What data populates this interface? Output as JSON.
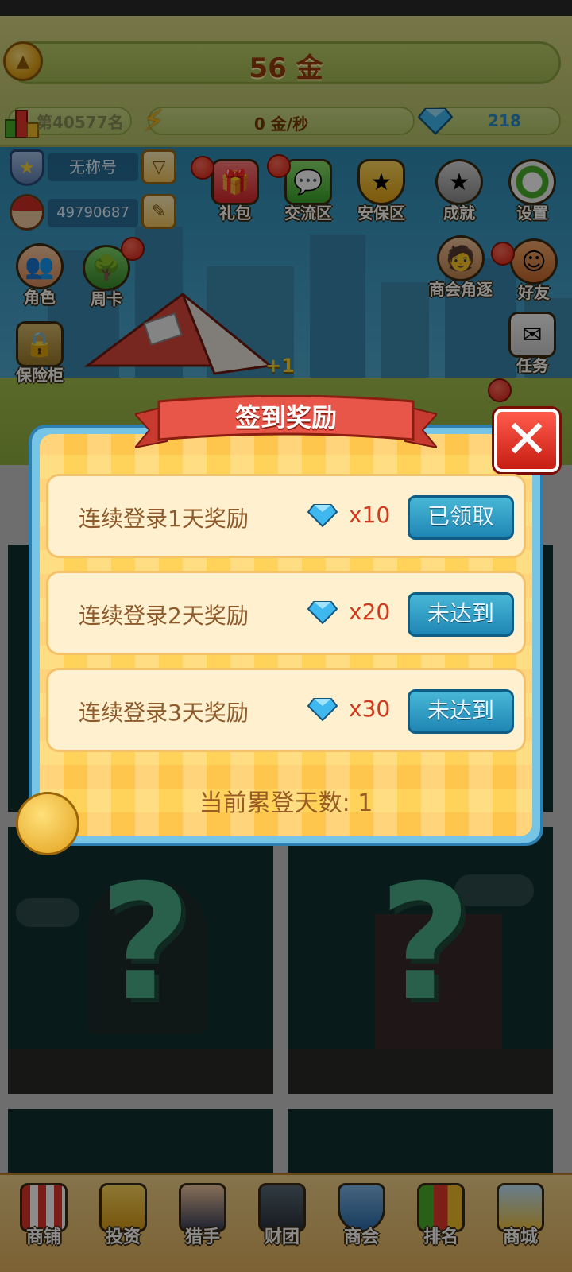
{
  "hud": {
    "gold": "56 金",
    "rank": "第40577名",
    "speed": "0 金/秒",
    "gems": "218"
  },
  "profile": {
    "title": "无称号",
    "user_id": "49790687"
  },
  "scene_buttons": {
    "gift": "礼包",
    "chat": "交流区",
    "security": "安保区",
    "achievement": "成就",
    "settings": "设置",
    "role": "角色",
    "weekly_card": "周卡",
    "guild_rival": "商会角逐",
    "friends": "好友",
    "safe": "保险柜",
    "tasks": "任务"
  },
  "tent_bonus": "+1",
  "dialog": {
    "title": "签到奖励",
    "rewards": [
      {
        "label": "连续登录1天奖励",
        "qty": "x10",
        "button": "已领取"
      },
      {
        "label": "连续登录2天奖励",
        "qty": "x20",
        "button": "未达到"
      },
      {
        "label": "连续登录3天奖励",
        "qty": "x30",
        "button": "未达到"
      }
    ],
    "days": "当前累登天数: 1"
  },
  "bottom_nav": [
    "商铺",
    "投资",
    "猎手",
    "财团",
    "商会",
    "排名",
    "商城"
  ],
  "colors": {
    "dialog_bg": "#ffd35a",
    "row_bg": "#fff0cf",
    "button_blue": "#1f86b4",
    "close_red": "#c71d12",
    "gem_blue": "#2d8cc8"
  }
}
